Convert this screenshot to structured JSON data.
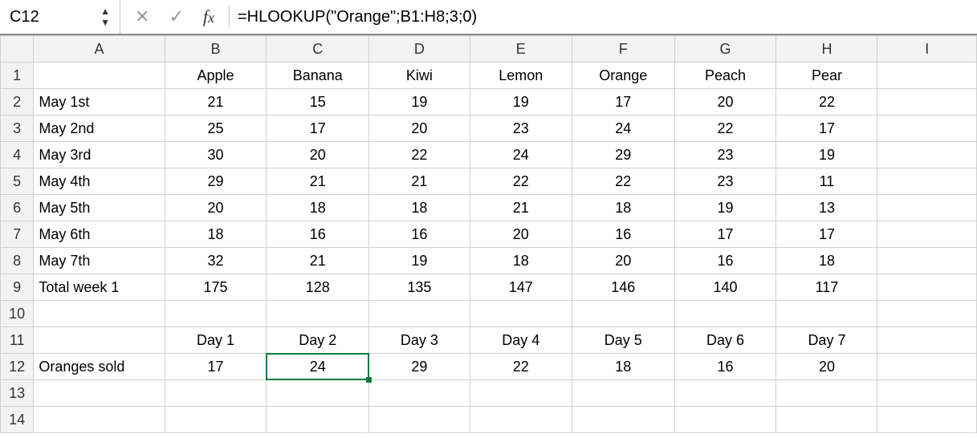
{
  "formula_bar": {
    "name_box": "C12",
    "formula": "=HLOOKUP(\"Orange\";B1:H8;3;0)"
  },
  "columns": [
    "A",
    "B",
    "C",
    "D",
    "E",
    "F",
    "G",
    "H",
    "I"
  ],
  "row_count": 14,
  "selected_cell": "C12",
  "rows": {
    "1": {
      "B": "Apple",
      "C": "Banana",
      "D": "Kiwi",
      "E": "Lemon",
      "F": "Orange",
      "G": "Peach",
      "H": "Pear"
    },
    "2": {
      "A": "May 1st",
      "B": "21",
      "C": "15",
      "D": "19",
      "E": "19",
      "F": "17",
      "G": "20",
      "H": "22"
    },
    "3": {
      "A": "May 2nd",
      "B": "25",
      "C": "17",
      "D": "20",
      "E": "23",
      "F": "24",
      "G": "22",
      "H": "17"
    },
    "4": {
      "A": "May 3rd",
      "B": "30",
      "C": "20",
      "D": "22",
      "E": "24",
      "F": "29",
      "G": "23",
      "H": "19"
    },
    "5": {
      "A": "May 4th",
      "B": "29",
      "C": "21",
      "D": "21",
      "E": "22",
      "F": "22",
      "G": "23",
      "H": "11"
    },
    "6": {
      "A": "May 5th",
      "B": "20",
      "C": "18",
      "D": "18",
      "E": "21",
      "F": "18",
      "G": "19",
      "H": "13"
    },
    "7": {
      "A": "May 6th",
      "B": "18",
      "C": "16",
      "D": "16",
      "E": "20",
      "F": "16",
      "G": "17",
      "H": "17"
    },
    "8": {
      "A": "May 7th",
      "B": "32",
      "C": "21",
      "D": "19",
      "E": "18",
      "F": "20",
      "G": "16",
      "H": "18"
    },
    "9": {
      "A": "Total week 1",
      "B": "175",
      "C": "128",
      "D": "135",
      "E": "147",
      "F": "146",
      "G": "140",
      "H": "117"
    },
    "11": {
      "B": "Day 1",
      "C": "Day 2",
      "D": "Day 3",
      "E": "Day 4",
      "F": "Day 5",
      "G": "Day 6",
      "H": "Day 7"
    },
    "12": {
      "A": "Oranges sold",
      "B": "17",
      "C": "24",
      "D": "29",
      "E": "22",
      "F": "18",
      "G": "16",
      "H": "20"
    }
  },
  "bold_rows_full": [
    "9"
  ],
  "bold_cols_in_row": {
    "1": [
      "B",
      "C",
      "D",
      "E",
      "F",
      "G",
      "H"
    ],
    "11": [
      "B",
      "C",
      "D",
      "E",
      "F",
      "G",
      "H"
    ]
  },
  "bold_colA_rows": [
    "2",
    "3",
    "4",
    "5",
    "6",
    "7",
    "8",
    "9",
    "12"
  ]
}
